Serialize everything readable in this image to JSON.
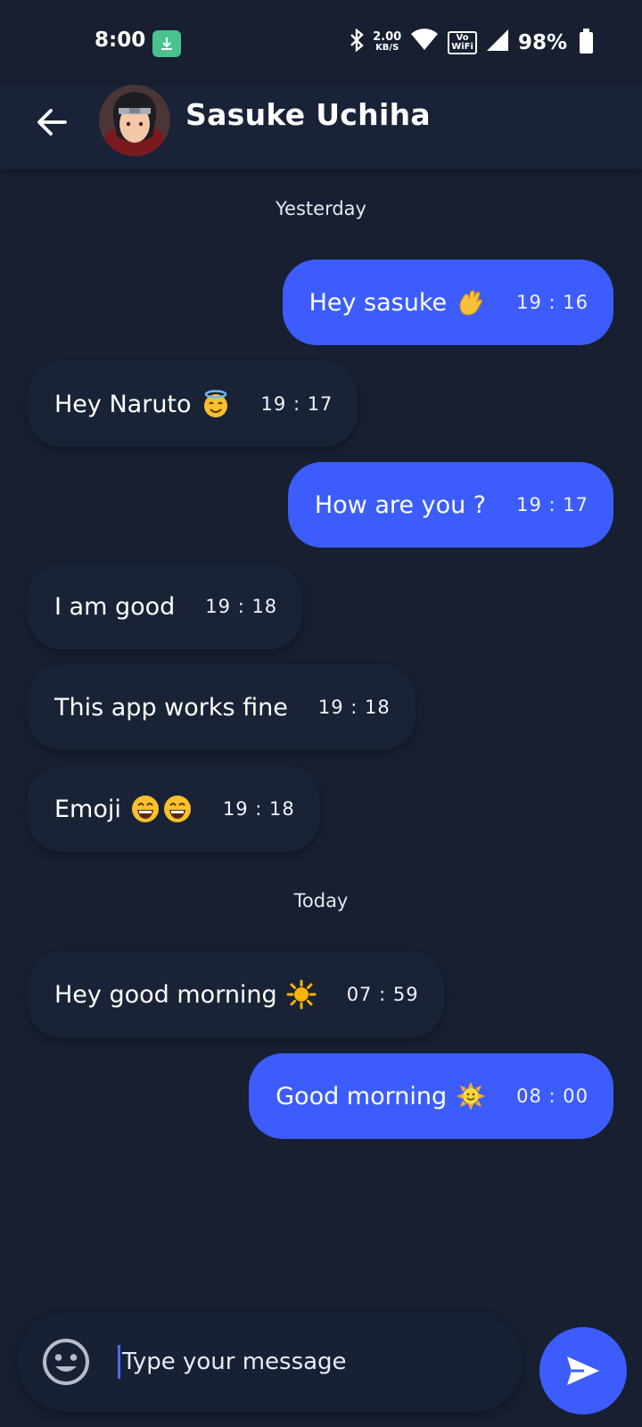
{
  "status_bar": {
    "time": "8:00",
    "speed_value": "2.00",
    "speed_unit": "KB/S",
    "vowifi_top": "Vo",
    "vowifi_bottom": "WiFi",
    "battery": "98%"
  },
  "header": {
    "contact_name": "Sasuke Uchiha"
  },
  "days": {
    "yesterday": "Yesterday",
    "today": "Today"
  },
  "messages": [
    {
      "text": "Hey sasuke",
      "emoji": "wave",
      "time": "19 : 16",
      "direction": "outgoing"
    },
    {
      "text": "Hey Naruto",
      "emoji": "halo",
      "time": "19 : 17",
      "direction": "incoming"
    },
    {
      "text": "How are you ?",
      "time": "19 : 17",
      "direction": "outgoing"
    },
    {
      "text": "I am good",
      "time": "19 : 18",
      "direction": "incoming"
    },
    {
      "text": "This app works fine",
      "time": "19 : 18",
      "direction": "incoming"
    },
    {
      "text": "Emoji",
      "emoji": "grin-grin",
      "time": "19 : 18",
      "direction": "incoming"
    },
    {
      "text": "Hey good morning",
      "emoji": "sun",
      "time": "07 : 59",
      "direction": "incoming"
    },
    {
      "text": "Good morning",
      "emoji": "sun-with-face",
      "time": "08 : 00",
      "direction": "outgoing"
    }
  ],
  "composer": {
    "placeholder": "Type your message"
  },
  "colors": {
    "background": "#171f31",
    "outgoing_bubble": "#3c5dfc",
    "incoming_bubble": "#1a2336",
    "send_button": "#3c5dfc"
  }
}
